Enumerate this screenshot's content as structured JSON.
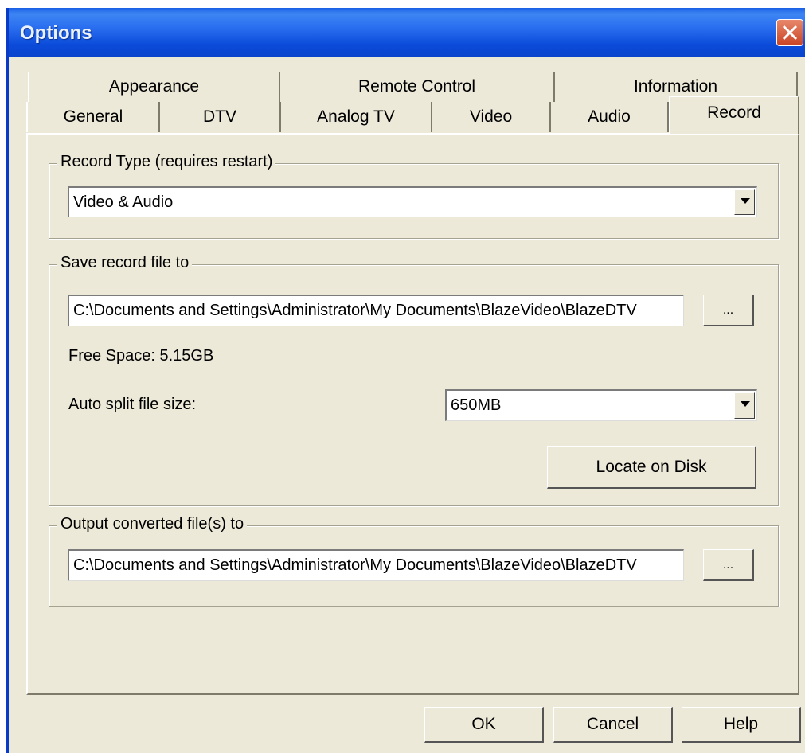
{
  "window": {
    "title": "Options"
  },
  "tabs": {
    "row1": [
      "Appearance",
      "Remote Control",
      "Information"
    ],
    "row2": [
      "General",
      "DTV",
      "Analog TV",
      "Video",
      "Audio",
      "Record"
    ]
  },
  "record_type": {
    "label": "Record Type (requires restart)",
    "value": "Video & Audio"
  },
  "save_record": {
    "label": "Save record file to",
    "path": "C:\\Documents and Settings\\Administrator\\My Documents\\BlazeVideo\\BlazeDTV",
    "browse_label": "...",
    "free_space": "Free Space: 5.15GB",
    "split_label": "Auto split file size:",
    "split_value": "650MB",
    "locate_label": "Locate on Disk"
  },
  "output_converted": {
    "label": "Output converted file(s) to",
    "path": "C:\\Documents and Settings\\Administrator\\My Documents\\BlazeVideo\\BlazeDTV",
    "browse_label": "..."
  },
  "footer": {
    "ok": "OK",
    "cancel": "Cancel",
    "help": "Help"
  },
  "colors": {
    "title_bar": "#0b4bd9",
    "dialog_bg": "#ece9d8",
    "close_button": "#c94424"
  }
}
